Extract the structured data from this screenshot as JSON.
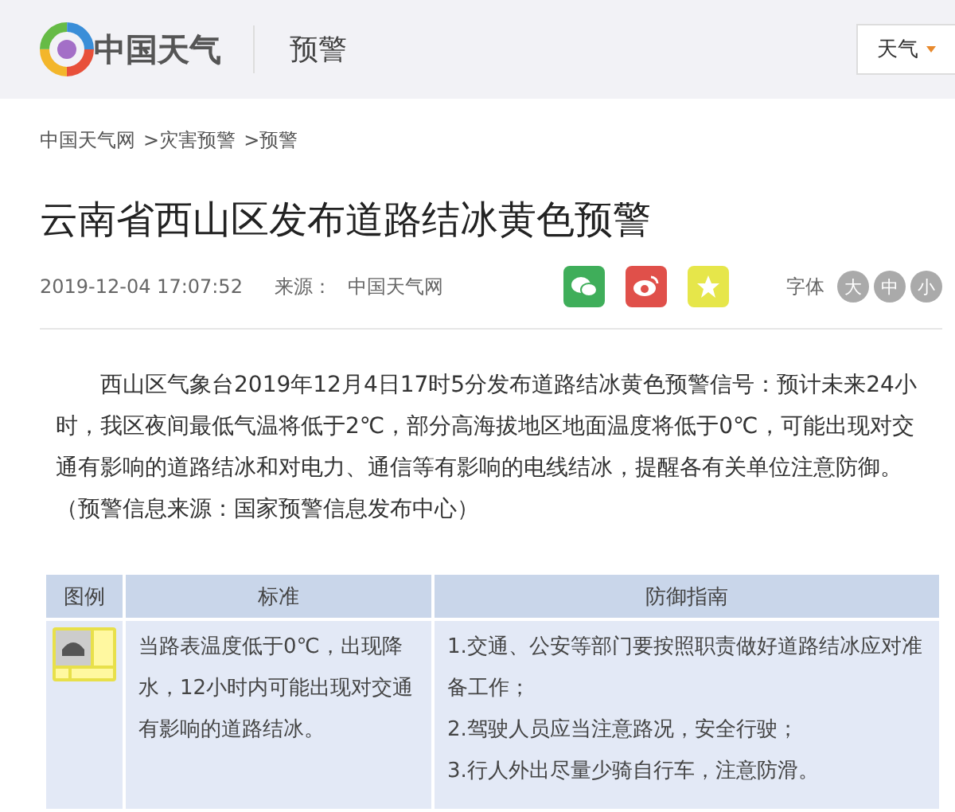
{
  "header": {
    "logo_text": "中国天气",
    "section": "预警",
    "menu": "天气"
  },
  "breadcrumb": [
    "中国天气网",
    ">灾害预警",
    ">预警"
  ],
  "article": {
    "title": "云南省西山区发布道路结冰黄色预警",
    "date": "2019-12-04 17:07:52",
    "source_label": "来源：",
    "source": "中国天气网",
    "font_label": "字体",
    "font_sizes": [
      "大",
      "中",
      "小"
    ],
    "paragraph": "西山区气象台2019年12月4日17时5分发布道路结冰黄色预警信号：预计未来24小时，我区夜间最低气温将低于2℃，部分高海拔地区地面温度将低于0℃，可能出现对交通有影响的道路结冰和对电力、通信等有影响的电线结冰，提醒各有关单位注意防御。（预警信息来源：国家预警信息发布中心）"
  },
  "table": {
    "columns": [
      "图例",
      "标准",
      "防御指南"
    ],
    "rows": [
      {
        "color": "#e8e04a",
        "standard": "当路表温度低于0℃，出现降水，12小时内可能出现对交通有影响的道路结冰。",
        "guide": [
          "1.交通、公安等部门要按照职责做好道路结冰应对准备工作；",
          "2.驾驶人员应当注意路况，安全行驶；",
          "3.行人外出尽量少骑自行车，注意防滑。"
        ]
      }
    ]
  }
}
